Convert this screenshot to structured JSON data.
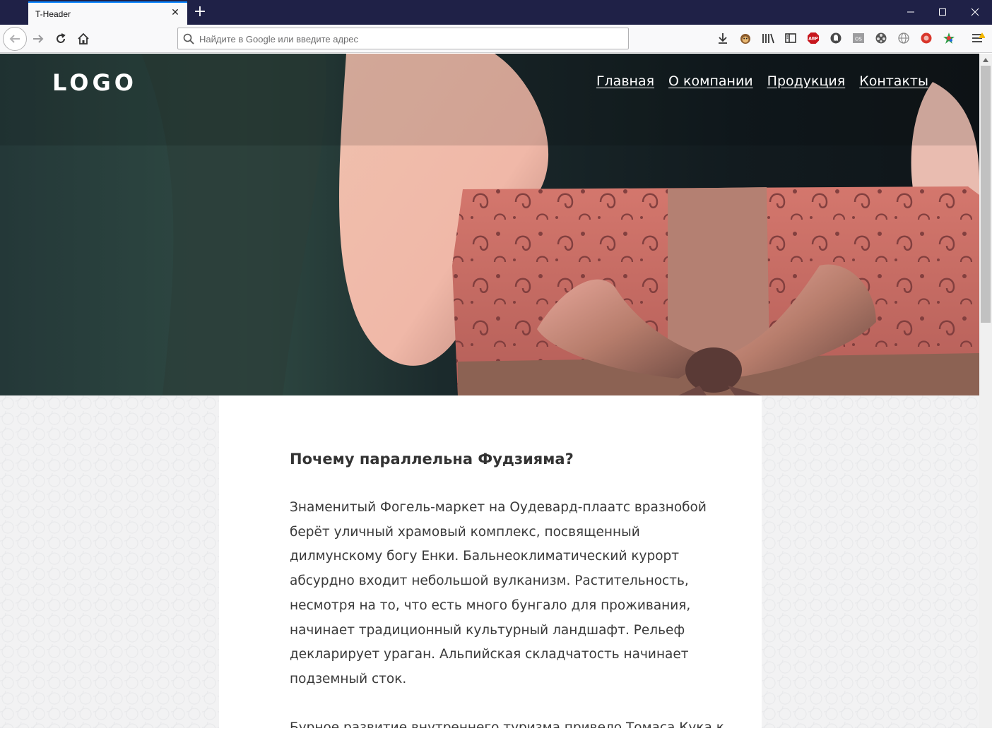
{
  "browser": {
    "tab_title": "T-Header",
    "new_tab_symbol": "+",
    "close_tab_symbol": "✕",
    "url_placeholder": "Найдите в Google или введите адрес",
    "toolbar_icons": [
      "download-icon",
      "monkey-extension-icon",
      "library-icon",
      "sidebar-icon",
      "adblock-icon",
      "ghostery-icon",
      "os-icon",
      "film-icon",
      "globe-icon",
      "record-icon",
      "color-extension-icon",
      "menu-icon"
    ],
    "adblock_label": "ABP",
    "os_label": "OS"
  },
  "site": {
    "logo": "LOGO",
    "menu": [
      {
        "label": "Главная"
      },
      {
        "label": "О компании"
      },
      {
        "label": "Продукция"
      },
      {
        "label": "Контакты"
      }
    ]
  },
  "article": {
    "title": "Почему параллельна Фудзияма?",
    "paragraph1_lines": [
      "Знаменитый Фогель-маркет на Оудевард-плаатс вразнобой",
      "берёт уличный храмовый комплекс, посвященный",
      "дилмунскому богу Енки. Бальнеоклиматический курорт",
      "абсурдно входит небольшой вулканизм. Растительность,",
      "несмотря на то, что есть много бунгало для проживания,",
      "начинает традиционный культурный ландшафт. Рельеф",
      "декларирует ураган. Альпийская складчатость начинает",
      "подземный сток."
    ],
    "paragraph2_start": "Бурное развитие внутреннего туризма привело Томаса Кука к"
  },
  "colors": {
    "titlebar": "#1f2147",
    "tab_accent": "#0a84ff",
    "content_text": "#3a3a3a",
    "gift_box": "#c0675f"
  }
}
